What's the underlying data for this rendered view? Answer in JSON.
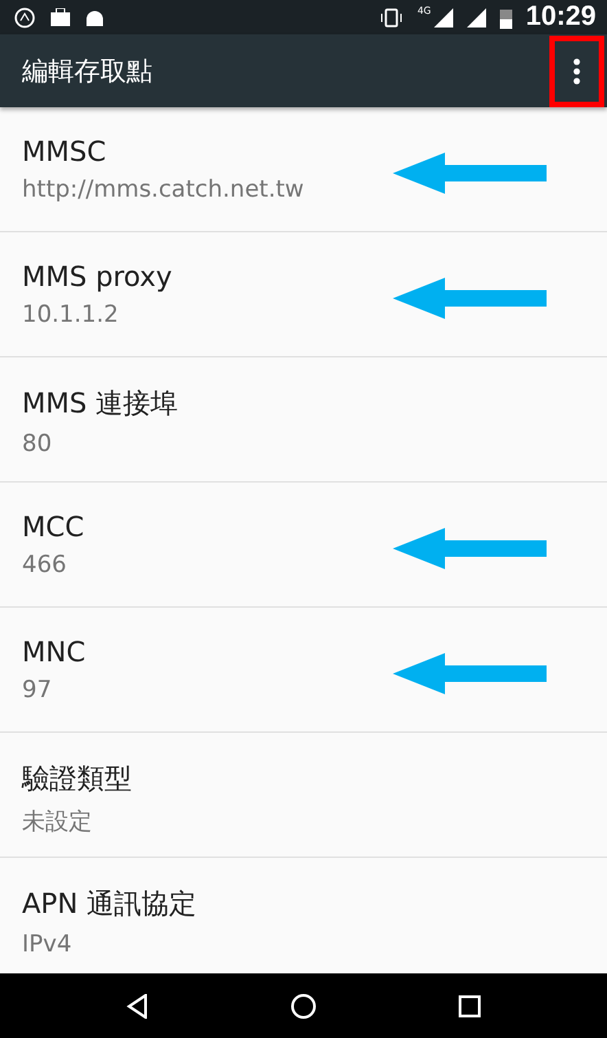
{
  "status_bar": {
    "network": "4G",
    "time": "10:29"
  },
  "toolbar": {
    "title": "編輯存取點",
    "menu_highlighted": true
  },
  "rows": [
    {
      "title": "MMSC",
      "value": "http://mms.catch.net.tw",
      "arrow": true
    },
    {
      "title": "MMS proxy",
      "value": "10.1.1.2",
      "arrow": true
    },
    {
      "title": "MMS 連接埠",
      "value": "80",
      "arrow": false
    },
    {
      "title": "MCC",
      "value": "466",
      "arrow": true
    },
    {
      "title": "MNC",
      "value": "97",
      "arrow": true
    },
    {
      "title": "驗證類型",
      "value": "未設定",
      "arrow": false
    },
    {
      "title": "APN 通訊協定",
      "value": "IPv4",
      "arrow": false
    }
  ]
}
